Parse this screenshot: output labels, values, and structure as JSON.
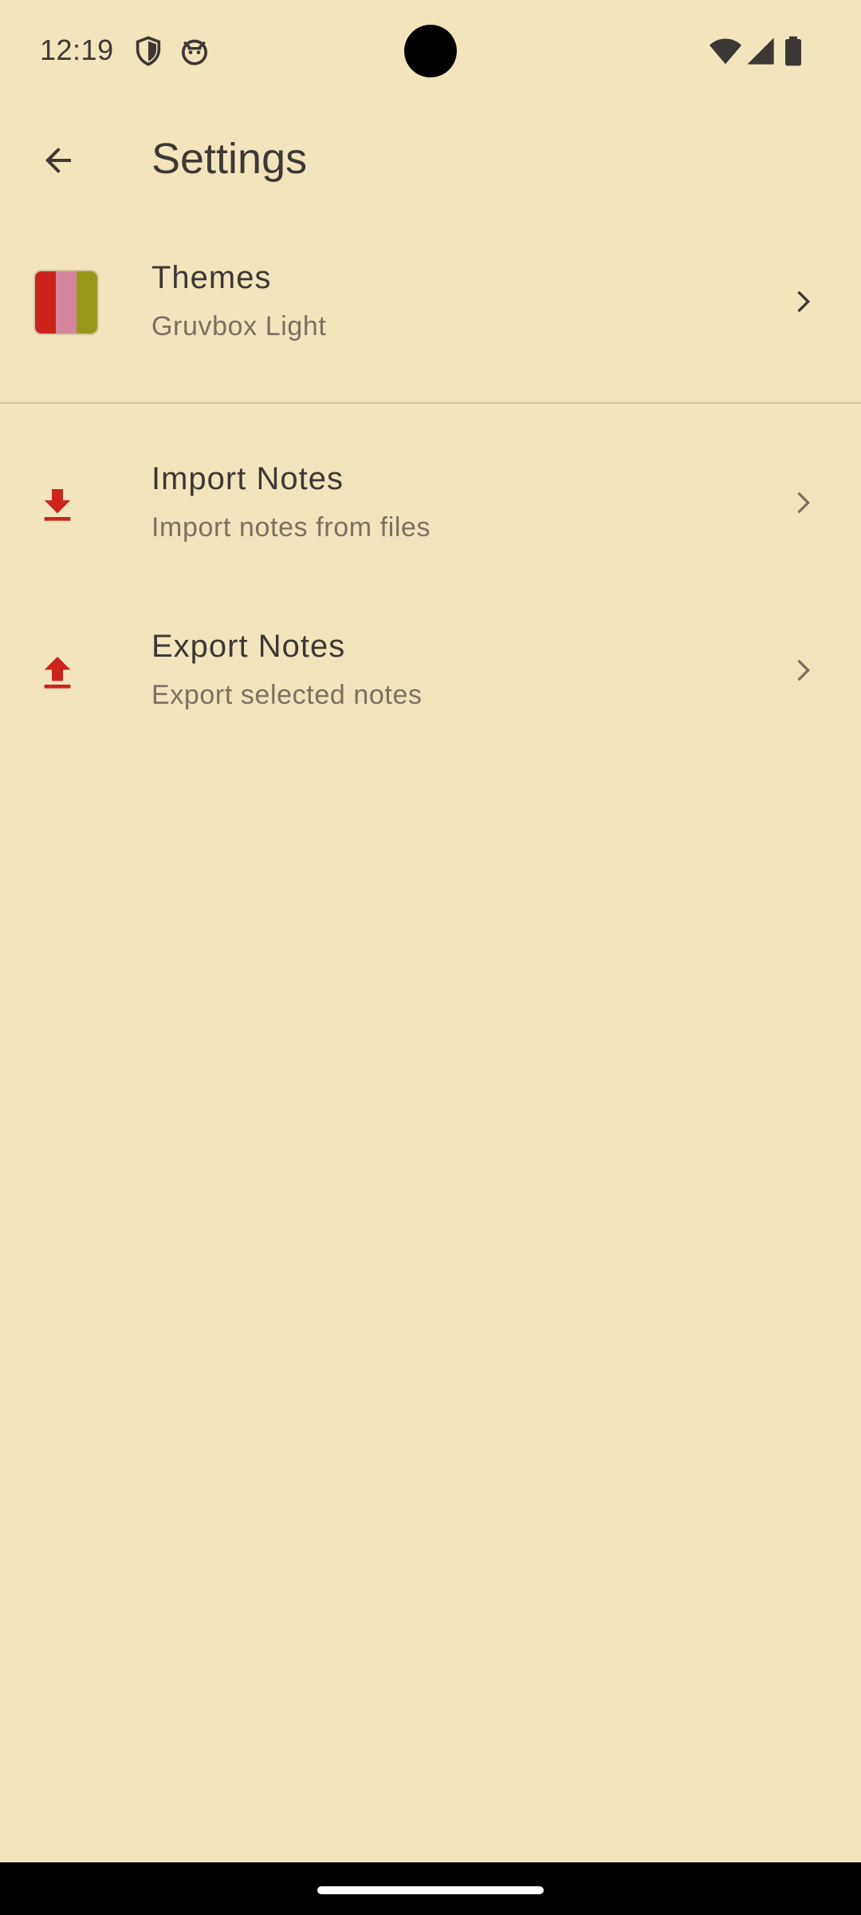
{
  "status_bar": {
    "time": "12:19",
    "icons": [
      "shield-icon",
      "cat-face-icon",
      "wifi-icon",
      "cellular-signal-icon",
      "battery-icon"
    ]
  },
  "app_bar": {
    "title": "Settings",
    "back_icon": "arrow-back-icon"
  },
  "settings": {
    "items": [
      {
        "title": "Themes",
        "subtitle": "Gruvbox Light",
        "icon": "theme-swatch",
        "swatch_colors": [
          "#CC241D",
          "#D3869B",
          "#98971A"
        ]
      },
      {
        "title": "Import Notes",
        "subtitle": "Import notes from files",
        "icon": "download-icon"
      },
      {
        "title": "Export Notes",
        "subtitle": "Export selected notes",
        "icon": "upload-icon"
      }
    ]
  },
  "colors": {
    "background": "#F2E5BC",
    "text_primary": "#3C3836",
    "text_secondary": "#7C6F64",
    "accent": "#CC241D",
    "divider": "#D5C4A1"
  }
}
